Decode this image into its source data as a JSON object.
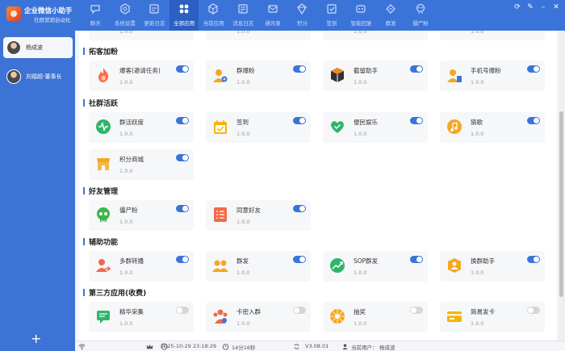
{
  "brand": {
    "title": "企业微信小助手",
    "subtitle": "社群营销自动化"
  },
  "nav": [
    {
      "label": "聊天",
      "icon": "chat-icon"
    },
    {
      "label": "系统设置",
      "icon": "settings-icon"
    },
    {
      "label": "更新日志",
      "icon": "update-log-icon"
    },
    {
      "label": "全部应用",
      "icon": "all-apps-icon",
      "active": true
    },
    {
      "label": "当前应用",
      "icon": "current-app-icon"
    },
    {
      "label": "消息日志",
      "icon": "message-log-icon"
    },
    {
      "label": "通讯录",
      "icon": "contacts-icon"
    },
    {
      "label": "积分",
      "icon": "points-icon"
    },
    {
      "label": "签到",
      "icon": "checkin-icon"
    },
    {
      "label": "智能回复",
      "icon": "smart-reply-icon"
    },
    {
      "label": "群发",
      "icon": "mass-send-icon"
    },
    {
      "label": "僵尸粉",
      "icon": "zombie-fans-icon"
    }
  ],
  "contacts": [
    {
      "name": "杨成波",
      "selected": true
    },
    {
      "name": "刘福超-董事长",
      "selected": false
    }
  ],
  "sidebar": {
    "add_label": "+"
  },
  "sections": [
    {
      "title": "拓客加粉"
    },
    {
      "title": "社群活跃"
    },
    {
      "title": "好友管理"
    },
    {
      "title": "辅助功能"
    },
    {
      "title": "第三方应用(收费)"
    }
  ],
  "top_partial_cards": [
    {
      "version": "1.0.0"
    },
    {
      "version": "1.0.0"
    },
    {
      "version": "1.0.0"
    },
    {
      "version": "1.0.0"
    }
  ],
  "apps": {
    "s0": [
      {
        "label": "爆客(邀请任务)",
        "version": "1.0.0",
        "on": true,
        "icon": "fire-icon",
        "color": "#ff6a3d"
      },
      {
        "label": "群爆粉",
        "version": "1.0.0",
        "on": true,
        "icon": "group-fans-icon",
        "color": "#f5a623"
      },
      {
        "label": "截留助手",
        "version": "1.0.0",
        "on": true,
        "icon": "cube-icon",
        "color": "#f08a24"
      },
      {
        "label": "手机号爆粉",
        "version": "1.0.0",
        "on": true,
        "icon": "phone-user-icon",
        "color": "#f5a623"
      }
    ],
    "s1": [
      {
        "label": "群活跃度",
        "version": "1.0.0",
        "on": true,
        "icon": "activity-icon",
        "color": "#2fb56a"
      },
      {
        "label": "签到",
        "version": "1.0.0",
        "on": true,
        "icon": "calendar-check-icon",
        "color": "#f5b400"
      },
      {
        "label": "便民娱乐",
        "version": "1.0.0",
        "on": true,
        "icon": "heart-check-icon",
        "color": "#2fb56a"
      },
      {
        "label": "猜歌",
        "version": "1.0.0",
        "on": true,
        "icon": "music-icon",
        "color": "#f5a623"
      },
      {
        "label": "积分商城",
        "version": "1.0.0",
        "on": true,
        "icon": "shop-icon",
        "color": "#f5a623"
      }
    ],
    "s2": [
      {
        "label": "僵尸粉",
        "version": "1.0.0",
        "on": true,
        "icon": "skull-icon",
        "color": "#3cb64a"
      },
      {
        "label": "同意好友",
        "version": "1.0.0",
        "on": true,
        "icon": "checklist-icon",
        "color": "#f06a4a"
      }
    ],
    "s3": [
      {
        "label": "多群转播",
        "version": "1.0.0",
        "on": true,
        "icon": "share-user-icon",
        "color": "#f06a4a"
      },
      {
        "label": "群发",
        "version": "1.0.0",
        "on": true,
        "icon": "users-icon",
        "color": "#f5a623"
      },
      {
        "label": "SOP群发",
        "version": "1.0.0",
        "on": true,
        "icon": "trend-icon",
        "color": "#2fb56a"
      },
      {
        "label": "换群助手",
        "version": "1.0.0",
        "on": true,
        "icon": "swap-group-icon",
        "color": "#f5a623"
      }
    ],
    "s4": [
      {
        "label": "精华采集",
        "version": "1.0.0",
        "on": false,
        "icon": "collect-icon",
        "color": "#2fb56a"
      },
      {
        "label": "卡密入群",
        "version": "1.0.0",
        "on": false,
        "icon": "card-group-icon",
        "color": "#f06a4a"
      },
      {
        "label": "抽奖",
        "version": "1.0.0",
        "on": false,
        "icon": "lottery-icon",
        "color": "#f5a623"
      },
      {
        "label": "简易发卡",
        "version": "1.0.0",
        "on": false,
        "icon": "card-icon",
        "color": "#f5b400"
      }
    ]
  },
  "status": {
    "datetime": "2025-10-29 23:18:29",
    "uptime": "14分16秒",
    "version": "V3.08.01",
    "current_user_label": "当前用户：",
    "current_user": "杨成波"
  }
}
